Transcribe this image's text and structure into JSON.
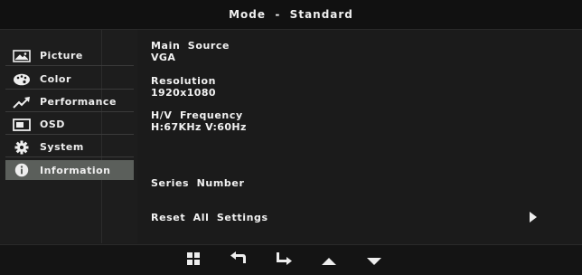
{
  "header": {
    "title": "Mode  -  Standard"
  },
  "sidebar": {
    "items": [
      {
        "label": "Picture",
        "icon": "picture-icon"
      },
      {
        "label": "Color",
        "icon": "palette-icon"
      },
      {
        "label": "Performance",
        "icon": "performance-icon"
      },
      {
        "label": "OSD",
        "icon": "osd-icon"
      },
      {
        "label": "System",
        "icon": "gear-icon"
      },
      {
        "label": "Information",
        "icon": "info-icon"
      }
    ],
    "active_index": 5
  },
  "information": {
    "main_source_label": "Main Source",
    "main_source_value": "VGA",
    "resolution_label": "Resolution",
    "resolution_value": "1920x1080",
    "hv_frequency_label": "H/V Frequency",
    "hv_frequency_value": "H:67KHz V:60Hz",
    "series_number_label": "Series Number",
    "reset_label": "Reset All Settings"
  },
  "bottom_nav": [
    {
      "icon": "menu-grid-icon"
    },
    {
      "icon": "back-arrow-icon"
    },
    {
      "icon": "enter-arrow-icon"
    },
    {
      "icon": "up-arrow-icon"
    },
    {
      "icon": "down-arrow-icon"
    }
  ],
  "colors": {
    "background": "#1b1b1b",
    "active_item": "#5b5f5b",
    "text": "#eeeeee"
  }
}
